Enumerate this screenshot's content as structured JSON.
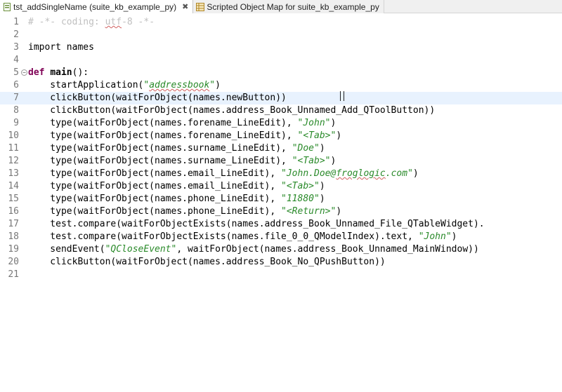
{
  "tabs": [
    {
      "label": "tst_addSingleName (suite_kb_example_py)",
      "close": "✖"
    },
    {
      "label": "Scripted Object Map for suite_kb_example_py"
    }
  ],
  "colors": {
    "keyword": "#7f0055",
    "string": "#2a8a2a",
    "comment": "#c0c0c0",
    "current_line": "#e8f2fe"
  },
  "editor": {
    "line_numbers": [
      "1",
      "2",
      "3",
      "4",
      "5",
      "6",
      "7",
      "8",
      "9",
      "10",
      "11",
      "12",
      "13",
      "14",
      "15",
      "16",
      "17",
      "18",
      "19",
      "20",
      "21"
    ],
    "lines": [
      [
        {
          "t": "# -*- coding: ",
          "c": "comment"
        },
        {
          "t": "utf",
          "c": "comment squig"
        },
        {
          "t": "-8 -*-",
          "c": "comment"
        }
      ],
      [],
      [
        {
          "t": "import",
          "c": "kw kw-plain"
        },
        {
          "t": " names"
        }
      ],
      [],
      [
        {
          "t": "def ",
          "c": "kw"
        },
        {
          "t": "main",
          "c": "kw-bold"
        },
        {
          "t": "():"
        }
      ],
      [
        {
          "t": "    startApplication("
        },
        {
          "t": "\"",
          "c": "str"
        },
        {
          "t": "addressbook",
          "c": "str squig"
        },
        {
          "t": "\"",
          "c": "str"
        },
        {
          "t": ")"
        }
      ],
      [
        {
          "t": "    clickButton(waitForObject(names.newButton))"
        }
      ],
      [
        {
          "t": "    clickButton(waitForObject(names.address_Book_Unnamed_Add_QToolButton))"
        }
      ],
      [
        {
          "t": "    type(waitForObject(names.forename_LineEdit), "
        },
        {
          "t": "\"John\"",
          "c": "str"
        },
        {
          "t": ")"
        }
      ],
      [
        {
          "t": "    type(waitForObject(names.forename_LineEdit), "
        },
        {
          "t": "\"<Tab>\"",
          "c": "str"
        },
        {
          "t": ")"
        }
      ],
      [
        {
          "t": "    type(waitForObject(names.surname_LineEdit), "
        },
        {
          "t": "\"Doe\"",
          "c": "str"
        },
        {
          "t": ")"
        }
      ],
      [
        {
          "t": "    type(waitForObject(names.surname_LineEdit), "
        },
        {
          "t": "\"<Tab>\"",
          "c": "str"
        },
        {
          "t": ")"
        }
      ],
      [
        {
          "t": "    type(waitForObject(names.email_LineEdit), "
        },
        {
          "t": "\"John.Doe@",
          "c": "str"
        },
        {
          "t": "froglogic",
          "c": "str squig"
        },
        {
          "t": ".com\"",
          "c": "str"
        },
        {
          "t": ")"
        }
      ],
      [
        {
          "t": "    type(waitForObject(names.email_LineEdit), "
        },
        {
          "t": "\"<Tab>\"",
          "c": "str"
        },
        {
          "t": ")"
        }
      ],
      [
        {
          "t": "    type(waitForObject(names.phone_LineEdit), "
        },
        {
          "t": "\"11880\"",
          "c": "str"
        },
        {
          "t": ")"
        }
      ],
      [
        {
          "t": "    type(waitForObject(names.phone_LineEdit), "
        },
        {
          "t": "\"<Return>\"",
          "c": "str"
        },
        {
          "t": ")"
        }
      ],
      [
        {
          "t": "    test.compare(waitForObjectExists(names.address_Book_Unnamed_File_QTableWidget)."
        }
      ],
      [
        {
          "t": "    test.compare(waitForObjectExists(names.file_0_0_QModelIndex).text, "
        },
        {
          "t": "\"John\"",
          "c": "str"
        },
        {
          "t": ")"
        }
      ],
      [
        {
          "t": "    sendEvent("
        },
        {
          "t": "\"QCloseEvent\"",
          "c": "str"
        },
        {
          "t": ", waitForObject(names.address_Book_Unnamed_MainWindow))"
        }
      ],
      [
        {
          "t": "    clickButton(waitForObject(names.address_Book_No_QPushButton))"
        }
      ],
      []
    ],
    "current_line": 7
  }
}
